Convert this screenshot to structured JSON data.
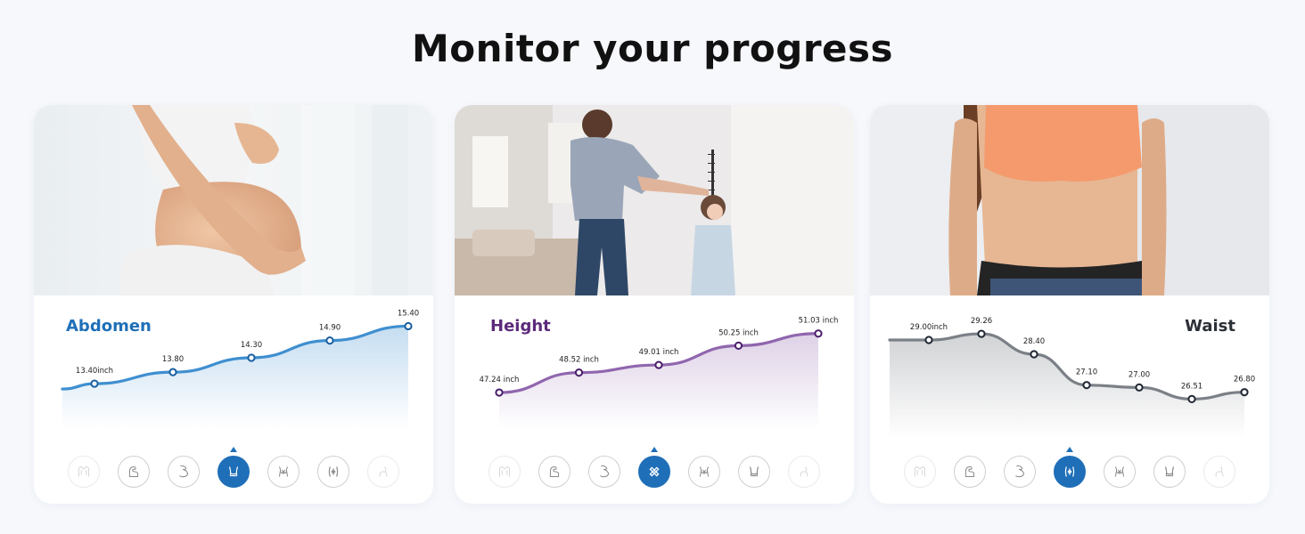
{
  "page": {
    "title": "Monitor your progress"
  },
  "colors": {
    "abdomen": "#3f8fd0",
    "abdomen_title": "#1f6fb8",
    "height": "#9066ae",
    "height_title": "#5b2a7a",
    "waist": "#7b8087",
    "waist_title": "#2b2f36",
    "active_icon": "#1f6fb8"
  },
  "cards": [
    {
      "photo": "pregnant-belly-photo",
      "metric": "Abdomen",
      "active_icon_index": 3,
      "icons": [
        "chest-icon",
        "bicep-icon",
        "flexed-arm-icon",
        "abdomen-icon",
        "bust-icon",
        "waist-icon",
        "thigh-icon"
      ]
    },
    {
      "photo": "mother-measuring-child-height-photo",
      "metric": "Height",
      "active_icon_index": 3,
      "icons": [
        "chest-icon",
        "bicep-icon",
        "flexed-arm-icon",
        "height-ruler-icon",
        "bust-icon",
        "abdomen-icon",
        "thigh-icon"
      ]
    },
    {
      "photo": "woman-sports-bra-waist-photo",
      "metric": "Waist",
      "active_icon_index": 3,
      "icons": [
        "chest-icon",
        "bicep-icon",
        "flexed-arm-icon",
        "waist-icon",
        "bust-icon",
        "abdomen-icon",
        "thigh-icon"
      ]
    }
  ],
  "chart_data": [
    {
      "type": "area",
      "title": "Abdomen",
      "unit": "inch",
      "values": [
        13.4,
        13.8,
        14.3,
        14.9,
        15.4
      ],
      "labels": [
        "13.40inch",
        "13.80",
        "14.30",
        "14.90",
        "15.40"
      ],
      "xlabel": "",
      "ylabel": "",
      "ylim": [
        13.0,
        15.6
      ],
      "grid": false
    },
    {
      "type": "area",
      "title": "Height",
      "unit": "inch",
      "values": [
        47.24,
        48.52,
        49.01,
        50.25,
        51.03
      ],
      "labels": [
        "47.24 inch",
        "48.52 inch",
        "49.01 inch",
        "50.25 inch",
        "51.03 inch"
      ],
      "xlabel": "",
      "ylabel": "",
      "ylim": [
        46.5,
        51.3
      ],
      "grid": false
    },
    {
      "type": "area",
      "title": "Waist",
      "unit": "inch",
      "values": [
        29.0,
        29.26,
        28.4,
        27.1,
        27.0,
        26.51,
        26.8
      ],
      "labels": [
        "29.00inch",
        "29.26",
        "28.40",
        "27.10",
        "27.00",
        "26.51",
        "26.80"
      ],
      "xlabel": "",
      "ylabel": "",
      "ylim": [
        26.0,
        29.6
      ],
      "grid": false
    }
  ]
}
